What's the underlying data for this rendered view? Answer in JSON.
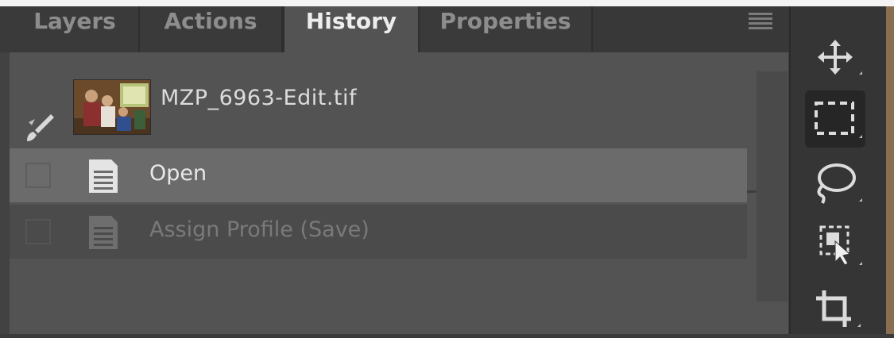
{
  "tabs": [
    {
      "label": "Layers",
      "active": false
    },
    {
      "label": "Actions",
      "active": false
    },
    {
      "label": "History",
      "active": true
    },
    {
      "label": "Properties",
      "active": false
    }
  ],
  "panel_menu_icon": "hamburger-menu-icon",
  "snapshot": {
    "label": "MZP_6963-Edit.tif",
    "icon": "history-brush-icon"
  },
  "history_states": [
    {
      "label": "Open",
      "state": "selected",
      "icon": "document-icon"
    },
    {
      "label": "Assign Profile (Save)",
      "state": "undone",
      "icon": "document-icon"
    }
  ],
  "tools": [
    {
      "name": "move-tool",
      "icon": "move-icon",
      "active": false
    },
    {
      "name": "rectangular-marquee-tool",
      "icon": "marquee-icon",
      "active": true
    },
    {
      "name": "lasso-tool",
      "icon": "lasso-icon",
      "active": false
    },
    {
      "name": "object-selection-tool",
      "icon": "object-selection-icon",
      "active": false
    },
    {
      "name": "crop-tool",
      "icon": "crop-icon",
      "active": false
    }
  ],
  "colors": {
    "panel_bg": "#535353",
    "tab_active_bg": "#535353",
    "selected_row_bg": "#6b6b6b",
    "toolbar_bg": "#353535",
    "right_border": "#8a6e52"
  }
}
